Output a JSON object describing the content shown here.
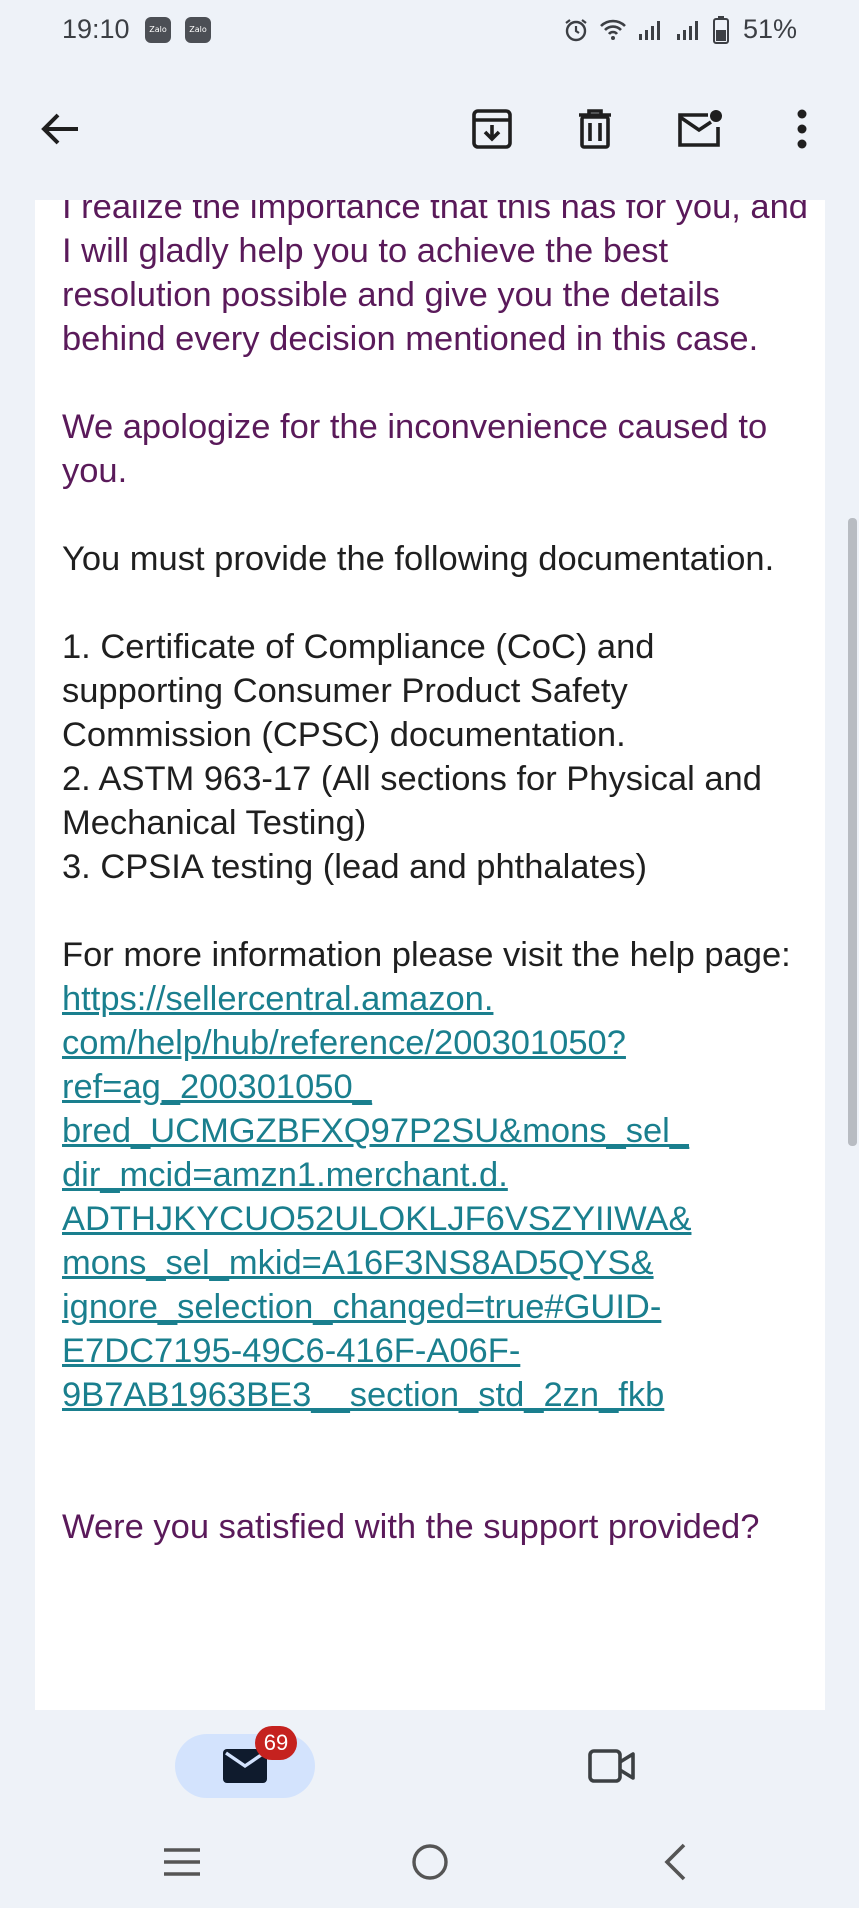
{
  "status": {
    "time": "19:10",
    "apps": [
      "Zalo",
      "Zalo"
    ],
    "battery_percent": "51%",
    "icons": [
      "alarm-icon",
      "wifi-icon",
      "signal-icon",
      "signal-icon",
      "battery-icon"
    ]
  },
  "toolbar": {
    "icons": [
      "back-arrow-icon",
      "archive-icon",
      "delete-icon",
      "mark-unread-icon",
      "more-vert-icon"
    ]
  },
  "message": {
    "para1": "I realize the importance that this has for you, and I will gladly help you to achieve the best resolution possible and give you the details behind every decision mentioned in this case.",
    "para2": "We apologize for the inconvenience caused to you.",
    "para3": "You must provide the following documentation.",
    "list": [
      "1. Certificate of Compliance (CoC) and supporting Consumer Product Safety Commission (CPSC) documentation.",
      "2. ASTM 963-17 (All sections for Physical and Mechanical Testing)",
      "3. CPSIA testing (lead and phthalates)"
    ],
    "help_text": "For more information please visit the help page:",
    "link_lines": [
      "https://sellercentral.amazon.",
      "com/help/hub/reference/200301050?",
      "ref=ag_200301050_",
      "bred_UCMGZBFXQ97P2SU&mons_sel_",
      "dir_mcid=amzn1.merchant.d.",
      "ADTHJKYCUO52ULOKLJF6VSZYIIWA&",
      "mons_sel_mkid=A16F3NS8AD5QYS&",
      "ignore_selection_changed=true#GUID-",
      "E7DC7195-49C6-416F-A06F-",
      "9B7AB1963BE3__section_std_2zn_fkb"
    ],
    "question": "Were you satisfied with the support provided?"
  },
  "bottom_nav": {
    "mail_badge": "69",
    "icons": [
      "mail-icon",
      "video-icon"
    ]
  },
  "colors": {
    "accent_purple": "#5a1a5a",
    "link": "#1a7f8e",
    "badge": "#c5221f",
    "pill": "#d3e3fd"
  }
}
